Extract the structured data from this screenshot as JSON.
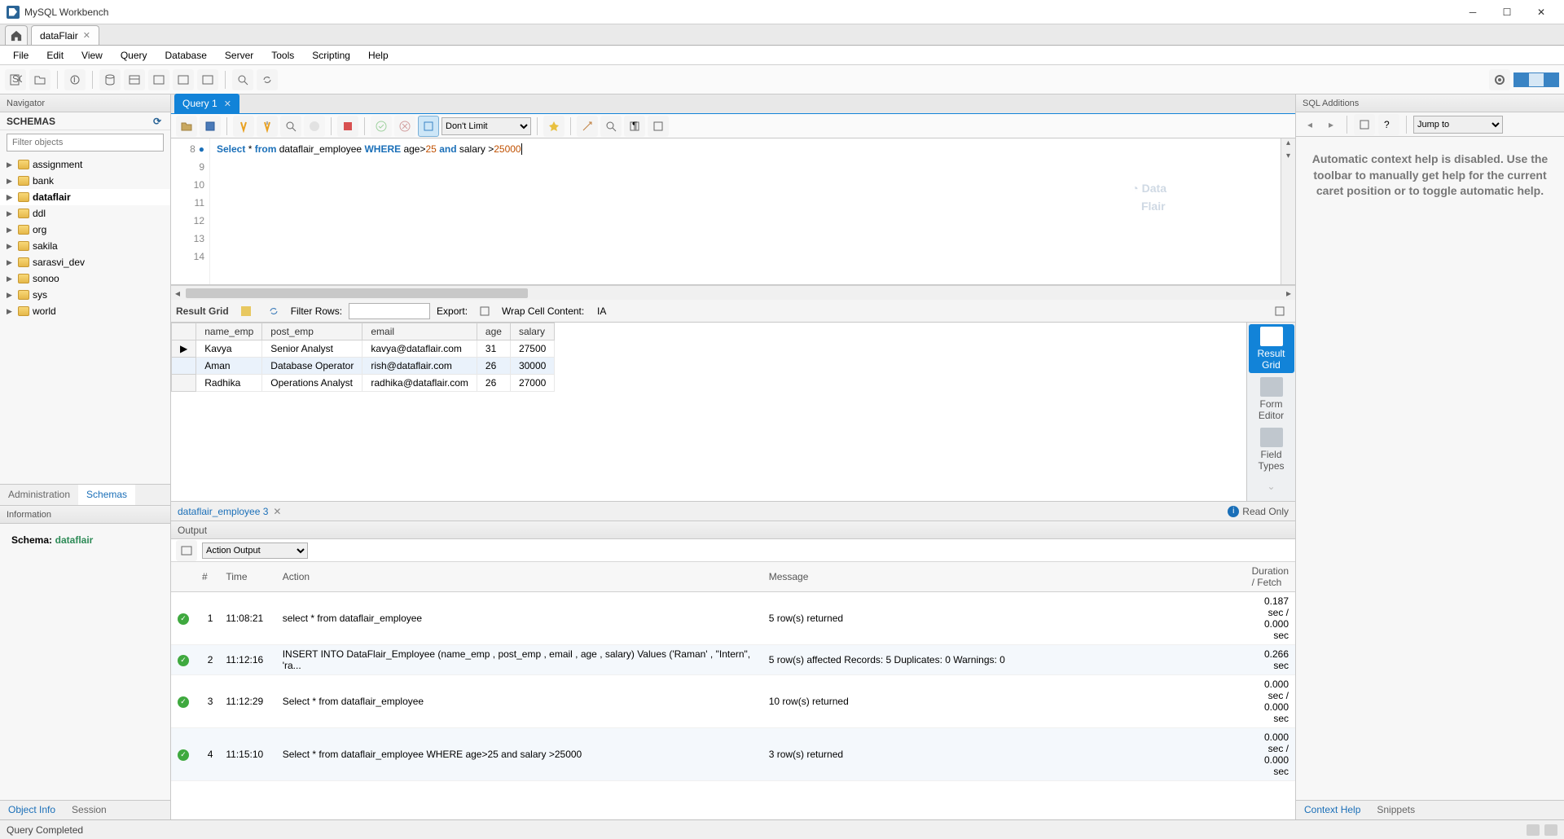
{
  "app": {
    "title": "MySQL Workbench"
  },
  "connection_tab": "dataFlair",
  "menu": [
    "File",
    "Edit",
    "View",
    "Query",
    "Database",
    "Server",
    "Tools",
    "Scripting",
    "Help"
  ],
  "navigator": {
    "title": "Navigator",
    "header": "SCHEMAS",
    "filter_placeholder": "Filter objects",
    "schemas": [
      "assignment",
      "bank",
      "dataflair",
      "ddl",
      "org",
      "sakila",
      "sarasvi_dev",
      "sonoo",
      "sys",
      "world"
    ],
    "selected": "dataflair",
    "tabs": [
      "Administration",
      "Schemas"
    ],
    "info_title": "Information",
    "schema_label": "Schema:",
    "schema_name": "dataflair",
    "bottom_tabs": [
      "Object Info",
      "Session"
    ]
  },
  "query": {
    "tab": "Query 1",
    "limit": "Don't Limit",
    "lines_start": 8,
    "line_count": 7,
    "sql_prefix": "Select",
    "sql_mid1": " * ",
    "sql_from": "from",
    "sql_mid2": " dataflair_employee ",
    "sql_where": "WHERE",
    "sql_mid3": " age>",
    "sql_n1": "25",
    "sql_and": " and ",
    "sql_mid4": "salary >",
    "sql_n2": "25000"
  },
  "result": {
    "grid_label": "Result Grid",
    "filter_label": "Filter Rows:",
    "export_label": "Export:",
    "wrap_label": "Wrap Cell Content:",
    "columns": [
      "name_emp",
      "post_emp",
      "email",
      "age",
      "salary"
    ],
    "rows": [
      {
        "c": [
          "Kavya",
          "Senior Analyst",
          "kavya@dataflair.com",
          "31",
          "27500"
        ],
        "sel": false,
        "ptr": true
      },
      {
        "c": [
          "Aman",
          "Database Operator",
          "rish@dataflair.com",
          "26",
          "30000"
        ],
        "sel": true,
        "ptr": false
      },
      {
        "c": [
          "Radhika",
          "Operations Analyst",
          "radhika@dataflair.com",
          "26",
          "27000"
        ],
        "sel": false,
        "ptr": false
      }
    ],
    "tabs": [
      "Result Grid",
      "Form Editor",
      "Field Types"
    ],
    "tab_name": "dataflair_employee 3",
    "readonly": "Read Only"
  },
  "output": {
    "title": "Output",
    "selector": "Action Output",
    "columns": [
      "",
      "#",
      "Time",
      "Action",
      "Message",
      "Duration / Fetch"
    ],
    "rows": [
      {
        "n": "1",
        "t": "11:08:21",
        "a": "select * from dataflair_employee",
        "m": "5 row(s) returned",
        "d": "0.187 sec / 0.000 sec"
      },
      {
        "n": "2",
        "t": "11:12:16",
        "a": "INSERT  INTO DataFlair_Employee (name_emp , post_emp , email , age , salary) Values ('Raman' ,  \"Intern\", 'ra...",
        "m": "5 row(s) affected Records: 5  Duplicates: 0  Warnings: 0",
        "d": "0.266 sec"
      },
      {
        "n": "3",
        "t": "11:12:29",
        "a": "Select * from dataflair_employee",
        "m": "10 row(s) returned",
        "d": "0.000 sec / 0.000 sec"
      },
      {
        "n": "4",
        "t": "11:15:10",
        "a": "Select * from dataflair_employee WHERE age>25 and salary >25000",
        "m": "3 row(s) returned",
        "d": "0.000 sec / 0.000 sec"
      }
    ]
  },
  "additions": {
    "title": "SQL Additions",
    "jump": "Jump to",
    "help": "Automatic context help is disabled. Use the toolbar to manually get help for the current caret position or to toggle automatic help.",
    "tabs": [
      "Context Help",
      "Snippets"
    ]
  },
  "status": "Query Completed"
}
